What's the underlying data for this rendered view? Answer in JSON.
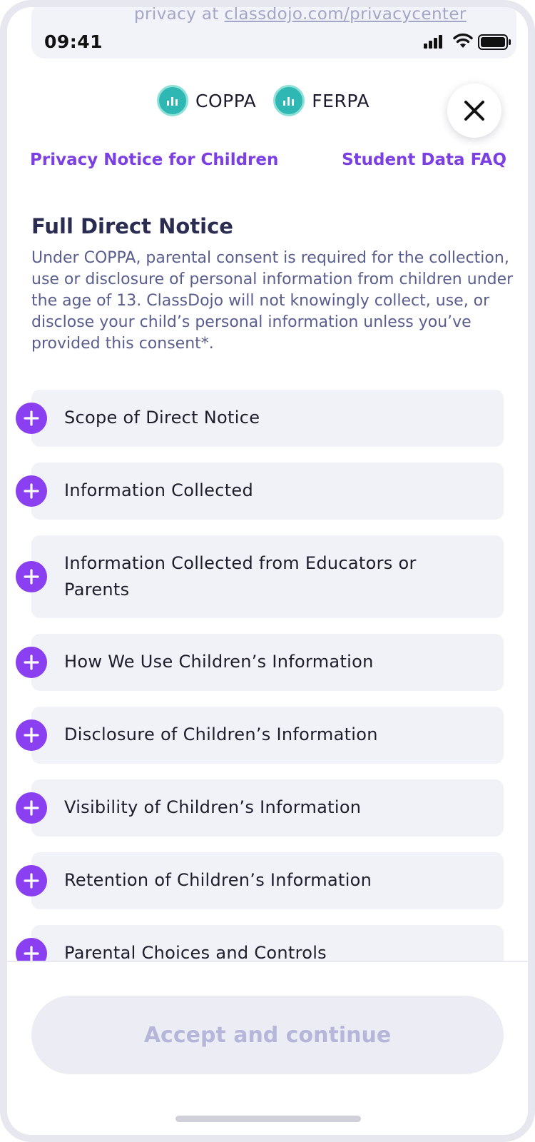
{
  "underlying": {
    "text_prefix": "privacy at ",
    "link": "classdojo.com/privacycenter"
  },
  "status_bar": {
    "time": "09:41"
  },
  "badges": [
    {
      "label": "COPPA",
      "icon": "coppa-seal-icon"
    },
    {
      "label": "FERPA",
      "icon": "ferpa-seal-icon"
    }
  ],
  "links": {
    "privacy_notice": "Privacy Notice for Children",
    "faq": "Student Data FAQ"
  },
  "notice": {
    "title": "Full Direct Notice",
    "body": "Under COPPA, parental consent is required for the collection, use or disclosure of personal information from children under the age of 13.  ClassDojo will not knowingly collect, use, or disclose your child’s personal information unless you’ve provided this consent*."
  },
  "accordion": [
    {
      "label": "Scope of Direct Notice"
    },
    {
      "label": "Information Collected"
    },
    {
      "label": "Information Collected from Educators or Parents"
    },
    {
      "label": "How We Use Children’s Information"
    },
    {
      "label": "Disclosure of Children’s Information"
    },
    {
      "label": "Visibility of Children’s Information"
    },
    {
      "label": "Retention of Children’s Information"
    },
    {
      "label": "Parental Choices and Controls"
    }
  ],
  "footer": {
    "accept_label": "Accept and continue"
  },
  "colors": {
    "accent": "#7b3fe4",
    "plus_button": "#8a3ff0",
    "badge_teal": "#2fb7b3",
    "item_bg": "#f1f2f8"
  }
}
